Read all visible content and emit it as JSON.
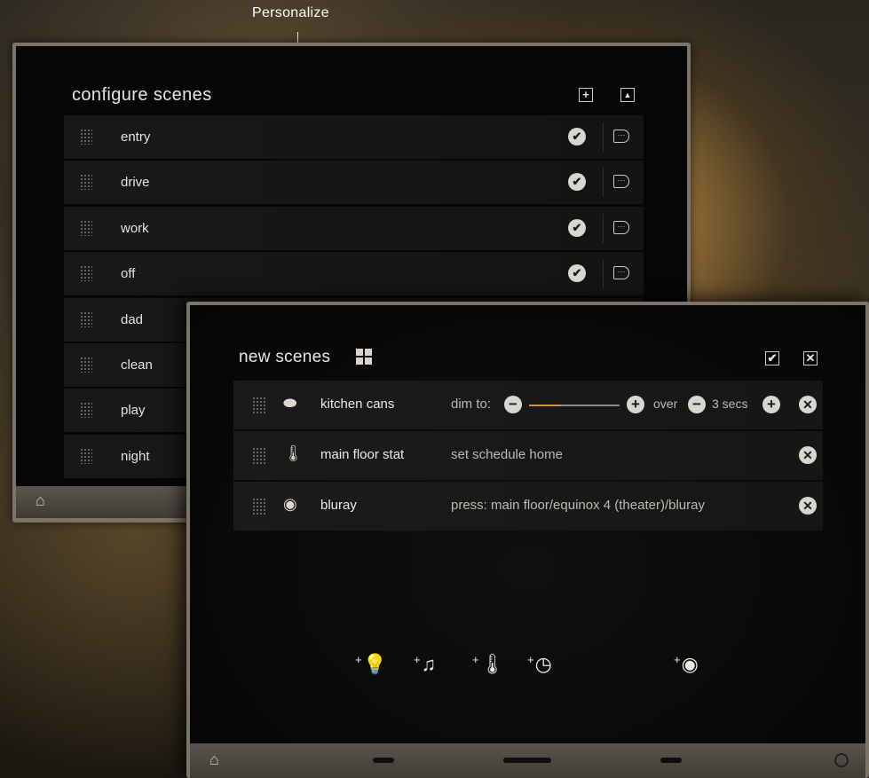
{
  "caption": "Personalize",
  "back_panel": {
    "title": "configure scenes",
    "add_icon": "plus-icon",
    "collapse_icon": "triangle-up-icon",
    "scenes": [
      {
        "label": "entry",
        "active": true
      },
      {
        "label": "drive",
        "active": true
      },
      {
        "label": "work",
        "active": true
      },
      {
        "label": "off",
        "active": true
      },
      {
        "label": "dad",
        "active": false
      },
      {
        "label": "clean",
        "active": false
      },
      {
        "label": "play",
        "active": false
      },
      {
        "label": "night",
        "active": false
      }
    ],
    "check_glyph": "✔",
    "goto_glyph": "···",
    "home_icon": "home-icon"
  },
  "front_panel": {
    "title": "new scenes",
    "confirm_glyph": "✔",
    "close_glyph": "✕",
    "rows": [
      {
        "icon": "ceiling-light-icon",
        "icon_glyph": "⬬",
        "name": "kitchen cans",
        "action_label": "dim to:",
        "level": 0.35,
        "over_label": "over",
        "duration": "3 secs"
      },
      {
        "icon": "thermostat-icon",
        "icon_glyph": "🌡",
        "name": "main floor stat",
        "action": "set schedule home"
      },
      {
        "icon": "button-icon",
        "icon_glyph": "◉",
        "name": "bluray",
        "action": "press: main floor/equinox 4 (theater)/bluray"
      }
    ],
    "remove_glyph": "✕",
    "minus_glyph": "−",
    "plus_glyph": "+",
    "add_buttons": [
      {
        "icon": "add-light-icon",
        "glyph": "💡"
      },
      {
        "icon": "add-music-icon",
        "glyph": "♫"
      },
      {
        "icon": "add-thermostat-icon",
        "glyph": "🌡"
      },
      {
        "icon": "add-timer-icon",
        "glyph": "◷"
      },
      {
        "icon": "add-button-icon",
        "glyph": "◉"
      }
    ],
    "add_prefix": "+"
  },
  "colors": {
    "accent": "#d6922e",
    "caption_marker": "#e8b23a"
  }
}
